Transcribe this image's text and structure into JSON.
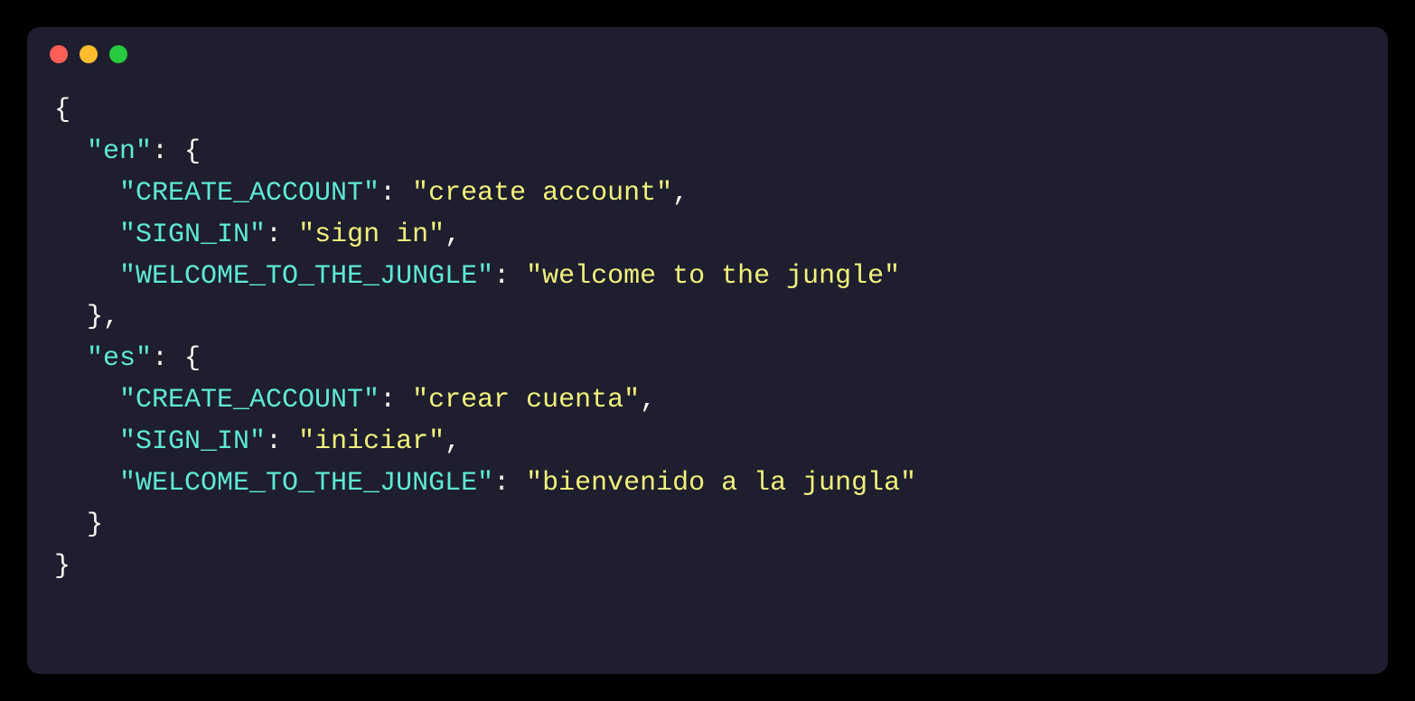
{
  "code": {
    "line1": "{",
    "line2_indent": "  ",
    "line2_key": "\"en\"",
    "line2_punct": ": {",
    "line3_indent": "    ",
    "line3_key": "\"CREATE_ACCOUNT\"",
    "line3_colon": ": ",
    "line3_value": "\"create account\"",
    "line3_comma": ",",
    "line4_indent": "    ",
    "line4_key": "\"SIGN_IN\"",
    "line4_colon": ": ",
    "line4_value": "\"sign in\"",
    "line4_comma": ",",
    "line5_indent": "    ",
    "line5_key": "\"WELCOME_TO_THE_JUNGLE\"",
    "line5_colon": ": ",
    "line5_value": "\"welcome to the jungle\"",
    "line6_indent": "  ",
    "line6_punct": "},",
    "line7_indent": "  ",
    "line7_key": "\"es\"",
    "line7_punct": ": {",
    "line8_indent": "    ",
    "line8_key": "\"CREATE_ACCOUNT\"",
    "line8_colon": ": ",
    "line8_value": "\"crear cuenta\"",
    "line8_comma": ",",
    "line9_indent": "    ",
    "line9_key": "\"SIGN_IN\"",
    "line9_colon": ": ",
    "line9_value": "\"iniciar\"",
    "line9_comma": ",",
    "line10_indent": "    ",
    "line10_key": "\"WELCOME_TO_THE_JUNGLE\"",
    "line10_colon": ": ",
    "line10_value": "\"bienvenido a la jungla\"",
    "line11_indent": "  ",
    "line11_punct": "}",
    "line12": "}"
  }
}
